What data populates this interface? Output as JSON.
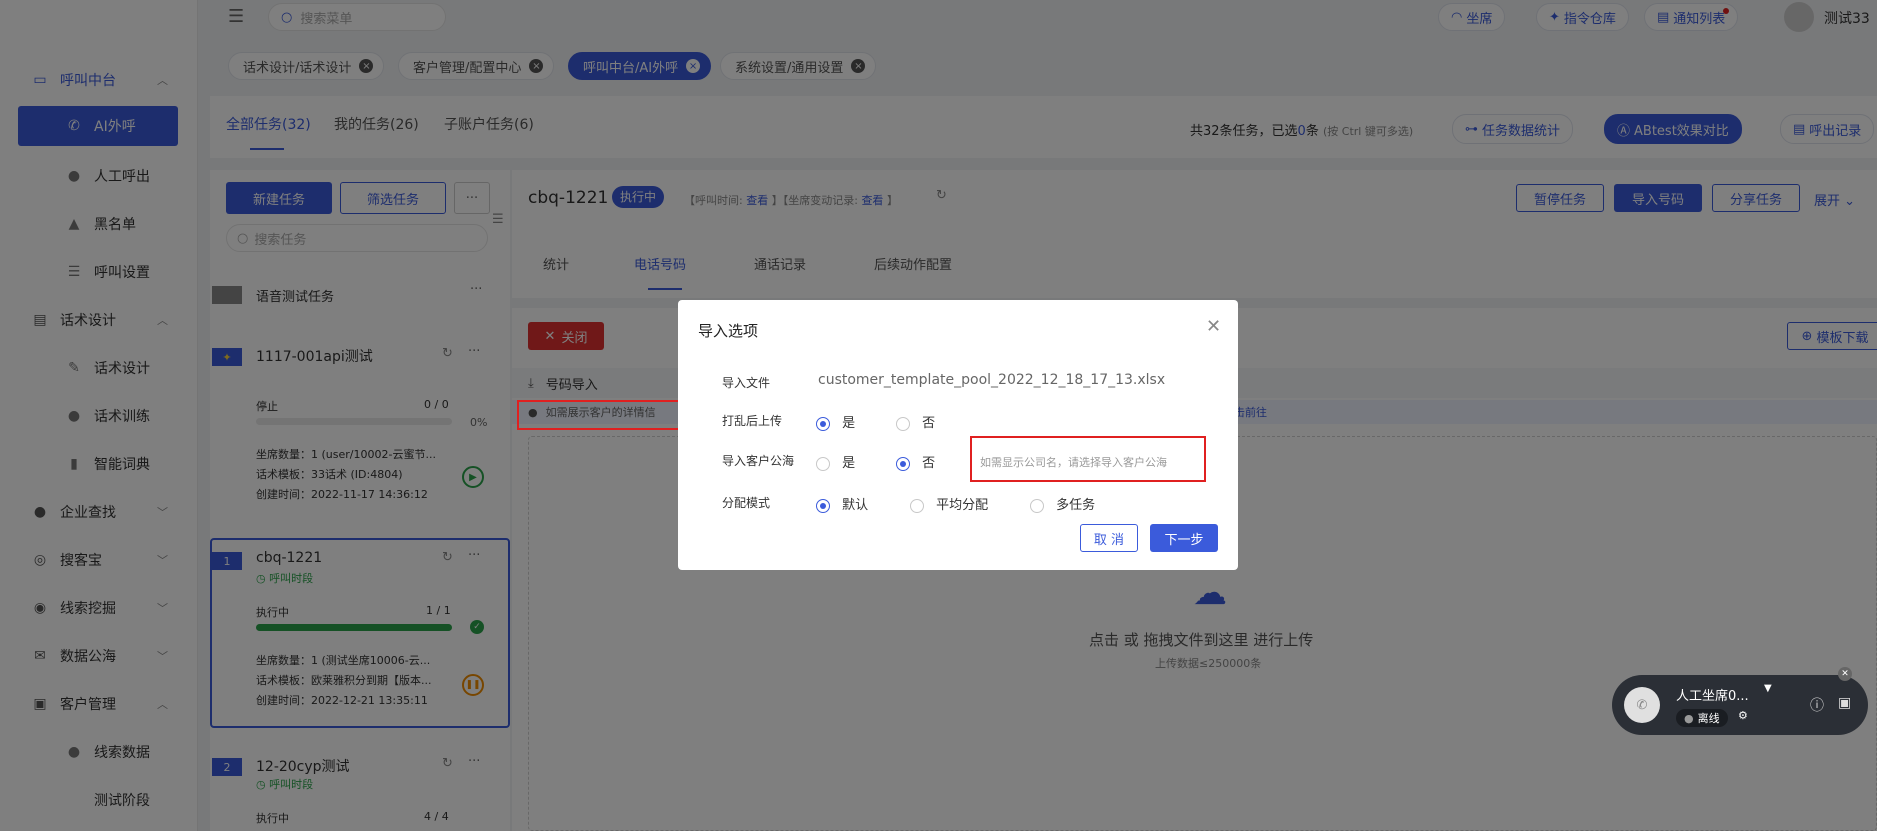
{
  "topbar": {
    "search_placeholder": "搜索菜单",
    "pills": [
      "坐席",
      "指令仓库",
      "通知列表"
    ],
    "user_name": "测试33"
  },
  "sidebar": {
    "items": [
      {
        "label": "呼叫中台",
        "icon": "monitor-icon"
      },
      {
        "label": "AI外呼",
        "icon": "phone-icon"
      },
      {
        "label": "人工呼出",
        "icon": "person-icon"
      },
      {
        "label": "黑名单",
        "icon": "warning-icon"
      },
      {
        "label": "呼叫设置",
        "icon": "sliders-icon"
      },
      {
        "label": "话术设计",
        "icon": "chat-icon"
      },
      {
        "label": "话术设计",
        "icon": "pen-icon"
      },
      {
        "label": "话术训练",
        "icon": "bubble-icon"
      },
      {
        "label": "智能词典",
        "icon": "book-icon"
      },
      {
        "label": "企业查找",
        "icon": "bulb-icon"
      },
      {
        "label": "搜客宝",
        "icon": "search-circle-icon"
      },
      {
        "label": "线索挖掘",
        "icon": "target-icon"
      },
      {
        "label": "数据公海",
        "icon": "mail-icon"
      },
      {
        "label": "客户管理",
        "icon": "contacts-icon"
      },
      {
        "label": "线索数据",
        "icon": "person-lock-icon"
      },
      {
        "label": "测试阶段",
        "icon": ""
      }
    ]
  },
  "tabs": [
    {
      "label": "话术设计/话术设计"
    },
    {
      "label": "客户管理/配置中心"
    },
    {
      "label": "呼叫中台/AI外呼"
    },
    {
      "label": "系统设置/通用设置"
    }
  ],
  "task_tabs": {
    "all": "全部任务(32)",
    "mine": "我的任务(26)",
    "sub": "子账户任务(6)",
    "summary_prefix": "共32条任务，已选",
    "summary_count": "0",
    "summary_suffix": "条",
    "summary_hint": "(按 Ctrl 键可多选)",
    "btn_stats": "任务数据统计",
    "btn_abtest": "ABtest效果对比",
    "btn_records": "呼出记录"
  },
  "left": {
    "new_task": "新建任务",
    "filter_task": "筛选任务",
    "more": "···",
    "search_placeholder": "搜索任务",
    "group_label": "语音测试任务",
    "tasks": [
      {
        "name": "1117-001api测试",
        "status": "停止",
        "progress_text": "0 / 0",
        "percent": "0%",
        "seats": "坐席数量：1 (user/10002-云蜜节...",
        "template": "话术模板：33话术 (ID:4804)",
        "created": "创建时间：2022-11-17 14:36:12",
        "progress": 0
      },
      {
        "index": "1",
        "name": "cbq-1221",
        "tag": "呼叫时段",
        "status": "执行中",
        "progress_text": "1 / 1",
        "seats": "坐席数量：1 (测试坐席10006-云...",
        "template": "话术模板：欧莱雅积分到期【版本...",
        "created": "创建时间：2022-12-21 13:35:11",
        "progress": 1
      },
      {
        "index": "2",
        "name": "12-20cyp测试",
        "tag": "呼叫时段",
        "status": "执行中",
        "progress_text": "4 / 4"
      }
    ]
  },
  "detail": {
    "title": "cbq-1221",
    "status": "执行中",
    "call_time_label": "【呼叫时间:",
    "view": "查看",
    "seat_change_label": "】【坐席变动记录:",
    "btns": [
      "暂停任务",
      "导入号码",
      "分享任务",
      "展开"
    ],
    "tabs": [
      "统计",
      "电话号码",
      "通话记录",
      "后续动作配置"
    ],
    "close_btn": "关闭",
    "template_download": "模板下载",
    "import_title": "号码导入",
    "notice": "如需展示客户的详情信",
    "notice_link": "击前往",
    "upload_text": "点击 或 拖拽文件到这里 进行上传",
    "upload_limit": "上传数据≤250000条"
  },
  "modal": {
    "title": "导入选项",
    "file_label": "导入文件",
    "file_value": "customer_template_pool_2022_12_18_17_13.xlsx",
    "shuffle_label": "打乱后上传",
    "yes": "是",
    "no": "否",
    "pool_label": "导入客户公海",
    "pool_hint": "如需显示公司名，请选择导入客户公海",
    "assign_label": "分配模式",
    "assign_default": "默认",
    "assign_avg": "平均分配",
    "assign_multi": "多任务",
    "cancel": "取 消",
    "next": "下一步"
  },
  "widget": {
    "name": "人工坐席0...",
    "status": "离线"
  },
  "colors": {
    "primary": "#3b5bdb",
    "danger": "#e02020",
    "success": "#2ba34a"
  }
}
